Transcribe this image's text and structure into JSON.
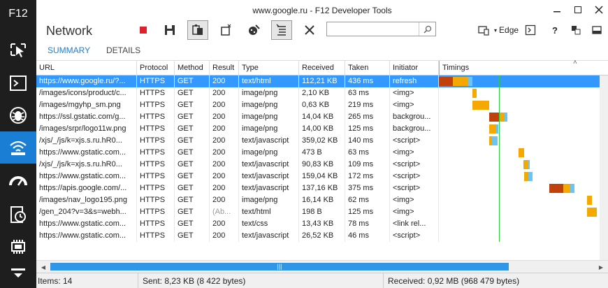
{
  "app": {
    "rail_title": "F12",
    "window_title": "www.google.ru - F12 Developer Tools",
    "tool_name": "Network"
  },
  "rail": {
    "items": [
      {
        "icon": "pointer-select-icon",
        "active": false
      },
      {
        "icon": "console-icon",
        "active": false
      },
      {
        "icon": "debugger-bug-icon",
        "active": false
      },
      {
        "icon": "network-wifi-icon",
        "active": true
      },
      {
        "icon": "performance-gauge-icon",
        "active": false
      },
      {
        "icon": "memory-timer-icon",
        "active": false
      },
      {
        "icon": "memory-chip-icon",
        "active": false
      },
      {
        "icon": "more-tools-icon",
        "active": false
      }
    ]
  },
  "toolbar": {
    "search_value": "",
    "search_placeholder": "",
    "mode_label": "Edge"
  },
  "tabs": [
    {
      "label": "SUMMARY",
      "active": true
    },
    {
      "label": "DETAILS",
      "active": false
    }
  ],
  "grid": {
    "columns": [
      "URL",
      "Protocol",
      "Method",
      "Result",
      "Type",
      "Received",
      "Taken",
      "Initiator",
      "Timings"
    ],
    "rows": [
      {
        "url": "https://www.google.ru/?...",
        "protocol": "HTTPS",
        "method": "GET",
        "result": "200",
        "type": "text/html",
        "received": "112,21 KB",
        "taken": "436 ms",
        "initiator": "refresh",
        "selected": true
      },
      {
        "url": "/images/icons/product/c...",
        "protocol": "HTTPS",
        "method": "GET",
        "result": "200",
        "type": "image/png",
        "received": "2,10 KB",
        "taken": "63 ms",
        "initiator": "<img>",
        "selected": false
      },
      {
        "url": "/images/mgyhp_sm.png",
        "protocol": "HTTPS",
        "method": "GET",
        "result": "200",
        "type": "image/png",
        "received": "0,63 KB",
        "taken": "219 ms",
        "initiator": "<img>",
        "selected": false
      },
      {
        "url": "https://ssl.gstatic.com/g...",
        "protocol": "HTTPS",
        "method": "GET",
        "result": "200",
        "type": "image/png",
        "received": "14,04 KB",
        "taken": "265 ms",
        "initiator": "backgrou...",
        "selected": false
      },
      {
        "url": "/images/srpr/logo11w.png",
        "protocol": "HTTPS",
        "method": "GET",
        "result": "200",
        "type": "image/png",
        "received": "14,00 KB",
        "taken": "125 ms",
        "initiator": "backgrou...",
        "selected": false
      },
      {
        "url": "/xjs/_/js/k=xjs.s.ru.hR0...",
        "protocol": "HTTPS",
        "method": "GET",
        "result": "200",
        "type": "text/javascript",
        "received": "359,02 KB",
        "taken": "140 ms",
        "initiator": "<script>",
        "selected": false
      },
      {
        "url": "https://www.gstatic.com...",
        "protocol": "HTTPS",
        "method": "GET",
        "result": "200",
        "type": "image/png",
        "received": "473 B",
        "taken": "63 ms",
        "initiator": "<img>",
        "selected": false
      },
      {
        "url": "/xjs/_/js/k=xjs.s.ru.hR0...",
        "protocol": "HTTPS",
        "method": "GET",
        "result": "200",
        "type": "text/javascript",
        "received": "90,83 KB",
        "taken": "109 ms",
        "initiator": "<script>",
        "selected": false
      },
      {
        "url": "https://www.gstatic.com...",
        "protocol": "HTTPS",
        "method": "GET",
        "result": "200",
        "type": "text/javascript",
        "received": "159,04 KB",
        "taken": "172 ms",
        "initiator": "<script>",
        "selected": false
      },
      {
        "url": "https://apis.google.com/...",
        "protocol": "HTTPS",
        "method": "GET",
        "result": "200",
        "type": "text/javascript",
        "received": "137,16 KB",
        "taken": "375 ms",
        "initiator": "<script>",
        "selected": false
      },
      {
        "url": "/images/nav_logo195.png",
        "protocol": "HTTPS",
        "method": "GET",
        "result": "200",
        "type": "image/png",
        "received": "16,14 KB",
        "taken": "62 ms",
        "initiator": "<img>",
        "selected": false
      },
      {
        "url": "/gen_204?v=3&s=webh...",
        "protocol": "HTTPS",
        "method": "GET",
        "result": "(Ab...",
        "type": "text/html",
        "received": "198 B",
        "taken": "125 ms",
        "initiator": "<img>",
        "selected": false
      },
      {
        "url": "https://www.gstatic.com...",
        "protocol": "HTTPS",
        "method": "GET",
        "result": "200",
        "type": "text/css",
        "received": "13,43 KB",
        "taken": "78 ms",
        "initiator": "<link rel...",
        "selected": false
      },
      {
        "url": "https://www.gstatic.com...",
        "protocol": "HTTPS",
        "method": "GET",
        "result": "200",
        "type": "text/javascript",
        "received": "26,52 KB",
        "taken": "46 ms",
        "initiator": "<script>",
        "selected": false
      }
    ],
    "timing_colors": {
      "wait": "#c0420a",
      "receive": "#f5a800",
      "end": "#6cc4f0",
      "dom_line": "#2ecc40",
      "load_line": "#e01010"
    }
  },
  "status": {
    "items": "Items: 14",
    "sent": "Sent: 8,23 KB (8 422 bytes)",
    "received": "Received: 0,92 MB (968 479 bytes)"
  }
}
